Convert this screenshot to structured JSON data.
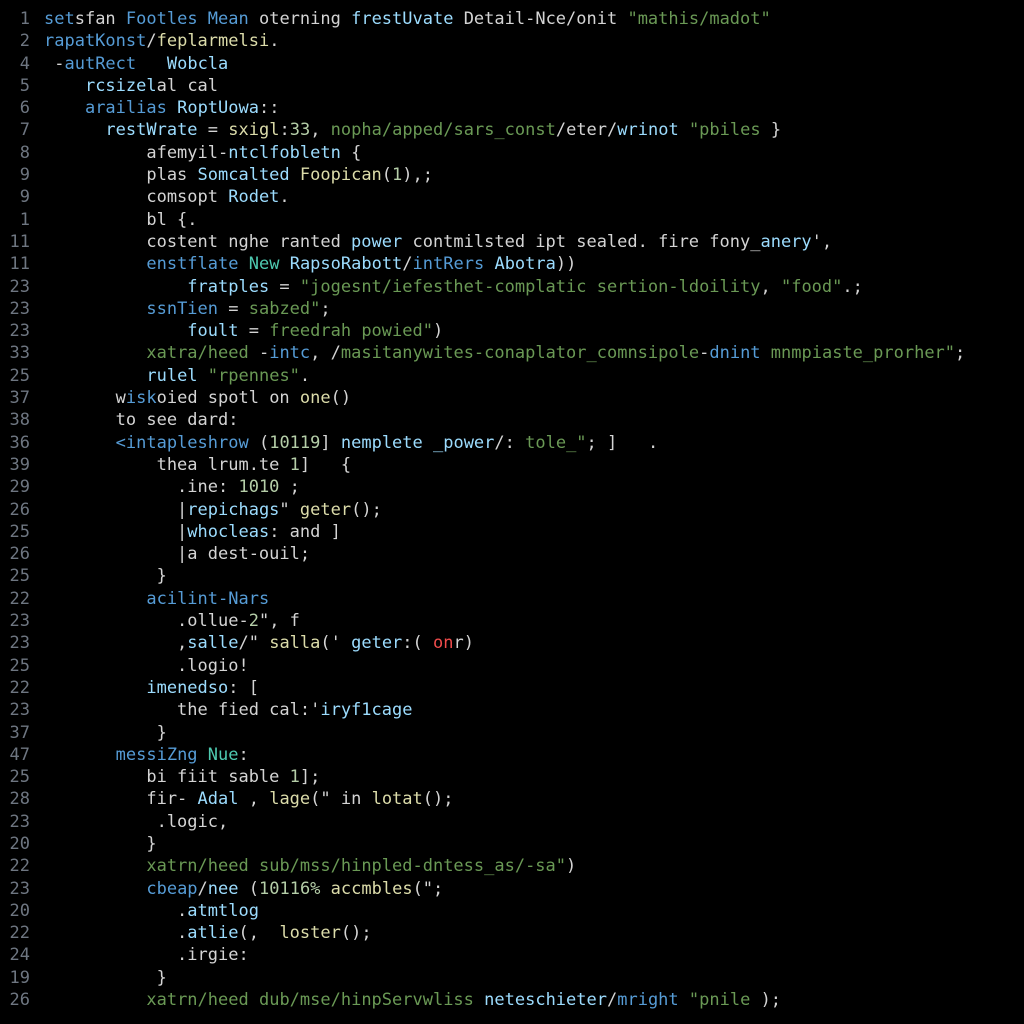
{
  "gutter": [
    "1",
    "2",
    "4",
    "5",
    "6",
    "7",
    "8",
    "9",
    "9",
    "1",
    "11",
    "11",
    "23",
    "23",
    "23",
    "33",
    "25",
    "37",
    "38",
    "36",
    "39",
    "29",
    "26",
    "25",
    "26",
    "25",
    "22",
    "23",
    "23",
    "25",
    "22",
    "23",
    "37",
    "47",
    "25",
    "28",
    "23",
    "20",
    "22",
    "23",
    "20",
    "22",
    "24",
    "19",
    "26"
  ],
  "lines": [
    [
      [
        "kw",
        "set"
      ],
      [
        "pun",
        "sfan "
      ],
      [
        "kw",
        "Footles Mean"
      ],
      [
        "pun",
        " oterning "
      ],
      [
        "fn",
        "frestUvate"
      ],
      [
        "pun",
        " Detail-Nce/onit "
      ],
      [
        "str",
        "\"mathis/madot\""
      ]
    ],
    [
      [
        "kw",
        "rapatKonst"
      ],
      [
        "pun",
        "/"
      ],
      [
        "fnY",
        "feplarmelsi"
      ],
      [
        "pun",
        "."
      ]
    ],
    [
      [
        "pun",
        " -"
      ],
      [
        "kw",
        "autRect"
      ],
      [
        "pun",
        "   "
      ],
      [
        "fn",
        "Wobcla"
      ]
    ],
    [
      [
        "pun",
        "    "
      ],
      [
        "fn",
        "rcsizel"
      ],
      [
        "pun",
        "al cal"
      ]
    ],
    [
      [
        "pun",
        "    "
      ],
      [
        "kw",
        "arailias"
      ],
      [
        "pun",
        " "
      ],
      [
        "fn",
        "RoptUowa"
      ],
      [
        "pun",
        "::"
      ]
    ],
    [
      [
        "pun",
        "      "
      ],
      [
        "fn",
        "restWrate"
      ],
      [
        "pun",
        " = "
      ],
      [
        "fnY",
        "sxigl"
      ],
      [
        "pun",
        ":"
      ],
      [
        "num",
        "33"
      ],
      [
        "pun",
        ", "
      ],
      [
        "str",
        "nopha/apped/sars_const"
      ],
      [
        "pun",
        "/eter/"
      ],
      [
        "fn",
        "wrinot"
      ],
      [
        "pun",
        " "
      ],
      [
        "str",
        "\"pbiles"
      ],
      [
        "pun",
        " }"
      ]
    ],
    [
      [
        "pun",
        "          afemyil-"
      ],
      [
        "fn",
        "ntclfobletn"
      ],
      [
        "pun",
        " {"
      ]
    ],
    [
      [
        "pun",
        "          plas "
      ],
      [
        "fn",
        "Somcalted"
      ],
      [
        "pun",
        " "
      ],
      [
        "fnY",
        "Foopican"
      ],
      [
        "pun",
        "("
      ],
      [
        "num",
        "1"
      ],
      [
        "pun",
        "),;"
      ]
    ],
    [
      [
        "pun",
        "          comsopt "
      ],
      [
        "fn",
        "Rodet"
      ],
      [
        "pun",
        "."
      ]
    ],
    [
      [
        "pun",
        "          bl {."
      ]
    ],
    [
      [
        "pun",
        "          costent nghe ranted "
      ],
      [
        "fn",
        "power"
      ],
      [
        "pun",
        " contmilsted ipt sealed. fire fony_"
      ],
      [
        "fn",
        "anery"
      ],
      [
        "pun",
        "',"
      ]
    ],
    [
      [
        "pun",
        "          "
      ],
      [
        "kw",
        "enstflate"
      ],
      [
        "pun",
        " "
      ],
      [
        "typ",
        "New"
      ],
      [
        "pun",
        " "
      ],
      [
        "fn",
        "RapsoRabott"
      ],
      [
        "pun",
        "/"
      ],
      [
        "kw",
        "intRers"
      ],
      [
        "pun",
        " "
      ],
      [
        "fn",
        "Abotra"
      ],
      [
        "pun",
        "))"
      ]
    ],
    [
      [
        "pun",
        "              "
      ],
      [
        "fn",
        "fratples"
      ],
      [
        "pun",
        " = "
      ],
      [
        "str",
        "\"jogesnt/iefesthet-complatic sertion-ldoility"
      ],
      [
        "pun",
        ", "
      ],
      [
        "str",
        "\"food\""
      ],
      [
        "pun",
        ".;"
      ]
    ],
    [
      [
        "pun",
        "          "
      ],
      [
        "kw",
        "ssnTien"
      ],
      [
        "pun",
        " = "
      ],
      [
        "str",
        "sabzed\""
      ],
      [
        "pun",
        ";"
      ]
    ],
    [
      [
        "pun",
        "              "
      ],
      [
        "fn",
        "foult"
      ],
      [
        "pun",
        " = "
      ],
      [
        "str",
        "freedrah powied\""
      ],
      [
        "pun",
        ")"
      ]
    ],
    [
      [
        "pun",
        "          "
      ],
      [
        "str",
        "xatra/heed"
      ],
      [
        "pun",
        " -"
      ],
      [
        "kw",
        "intc"
      ],
      [
        "pun",
        ", /"
      ],
      [
        "str",
        "masitanywites-conaplator_comnsipole"
      ],
      [
        "pun",
        "-"
      ],
      [
        "kw",
        "dnint"
      ],
      [
        "pun",
        " "
      ],
      [
        "str",
        "mnmpiaste_prorher\""
      ],
      [
        "pun",
        ";"
      ]
    ],
    [
      [
        "pun",
        "          "
      ],
      [
        "fn",
        "rulel"
      ],
      [
        "pun",
        " "
      ],
      [
        "str",
        "\"rpennes\""
      ],
      [
        "pun",
        "."
      ]
    ],
    [
      [
        "pun",
        "       w"
      ],
      [
        "kw",
        "isk"
      ],
      [
        "pun",
        "oied spotl on "
      ],
      [
        "fnY",
        "one"
      ],
      [
        "pun",
        "()"
      ]
    ],
    [
      [
        "pun",
        "       to see dard:"
      ]
    ],
    [
      [
        "pun",
        "       "
      ],
      [
        "kw",
        "<intapleshrow"
      ],
      [
        "pun",
        " ("
      ],
      [
        "num",
        "10119"
      ],
      [
        "pun",
        "] "
      ],
      [
        "fn",
        "nemplete _power"
      ],
      [
        "pun",
        "/: "
      ],
      [
        "str",
        "tole_\""
      ],
      [
        "pun",
        "; ]   ."
      ]
    ],
    [
      [
        "pun",
        "           thea lrum.te "
      ],
      [
        "num",
        "1"
      ],
      [
        "pun",
        "]   {"
      ]
    ],
    [
      [
        "pun",
        "             .ine: "
      ],
      [
        "num",
        "1010"
      ],
      [
        "pun",
        " ;"
      ]
    ],
    [
      [
        "pun",
        "             |"
      ],
      [
        "fn",
        "repichags"
      ],
      [
        "pun",
        "\" "
      ],
      [
        "fnY",
        "geter"
      ],
      [
        "pun",
        "();"
      ]
    ],
    [
      [
        "pun",
        "             |"
      ],
      [
        "fn",
        "whocleas"
      ],
      [
        "pun",
        ": and ]"
      ]
    ],
    [
      [
        "pun",
        "             |a dest-ouil;"
      ]
    ],
    [
      [
        "pun",
        "           }"
      ]
    ],
    [
      [
        "pun",
        "          "
      ],
      [
        "kw",
        "acilint-Nars"
      ]
    ],
    [
      [
        "pun",
        "             .ollue-"
      ],
      [
        "num",
        "2"
      ],
      [
        "pun",
        "\", f"
      ]
    ],
    [
      [
        "pun",
        "             ,"
      ],
      [
        "fn",
        "salle"
      ],
      [
        "pun",
        "/\" "
      ],
      [
        "fnY",
        "salla"
      ],
      [
        "pun",
        "(' "
      ],
      [
        "fn",
        "geter"
      ],
      [
        "pun",
        ":("
      ],
      [
        "err",
        " on"
      ],
      [
        "pun",
        "r)"
      ]
    ],
    [
      [
        "pun",
        "             .logio!"
      ]
    ],
    [
      [
        "pun",
        "          "
      ],
      [
        "fn",
        "imenedso"
      ],
      [
        "pun",
        ": ["
      ]
    ],
    [
      [
        "pun",
        "             the fied cal:'"
      ],
      [
        "fn",
        "iryf1cage"
      ]
    ],
    [
      [
        "pun",
        "           }"
      ]
    ],
    [
      [
        "pun",
        "       "
      ],
      [
        "kw",
        "messiZng"
      ],
      [
        "pun",
        " "
      ],
      [
        "typ",
        "Nue"
      ],
      [
        "pun",
        ":"
      ]
    ],
    [
      [
        "pun",
        "          bi fiit sable "
      ],
      [
        "num",
        "1"
      ],
      [
        "pun",
        "];"
      ]
    ],
    [
      [
        "pun",
        "          fir- "
      ],
      [
        "fn",
        "Adal"
      ],
      [
        "pun",
        " , "
      ],
      [
        "fnY",
        "lage"
      ],
      [
        "pun",
        "(\" in "
      ],
      [
        "fnY",
        "lotat"
      ],
      [
        "pun",
        "();"
      ]
    ],
    [
      [
        "pun",
        "           .logic,"
      ]
    ],
    [
      [
        "pun",
        "          }"
      ]
    ],
    [
      [
        "pun",
        "          "
      ],
      [
        "str",
        "xatrn/heed"
      ],
      [
        "pun",
        " "
      ],
      [
        "str",
        "sub/mss/hinpled-dntess_as/-sa\""
      ],
      [
        "pun",
        ")"
      ]
    ],
    [
      [
        "pun",
        "          "
      ],
      [
        "kw",
        "cbeap"
      ],
      [
        "pun",
        "/"
      ],
      [
        "fn",
        "nee"
      ],
      [
        "pun",
        " ("
      ],
      [
        "num",
        "10116%"
      ],
      [
        "pun",
        " "
      ],
      [
        "fnY",
        "accmbles"
      ],
      [
        "pun",
        "(\";"
      ]
    ],
    [
      [
        "pun",
        "             ."
      ],
      [
        "fn",
        "atmtlog"
      ],
      [
        "pun",
        ""
      ]
    ],
    [
      [
        "pun",
        "             ."
      ],
      [
        "fn",
        "atlie"
      ],
      [
        "pun",
        "(,  "
      ],
      [
        "fnY",
        "loster"
      ],
      [
        "pun",
        "();"
      ]
    ],
    [
      [
        "pun",
        "             .irgie:"
      ]
    ],
    [
      [
        "pun",
        "           }"
      ]
    ],
    [
      [
        "pun",
        "          "
      ],
      [
        "str",
        "xatrn/heed"
      ],
      [
        "pun",
        " "
      ],
      [
        "str",
        "dub/mse/hinpServwliss"
      ],
      [
        "pun",
        " "
      ],
      [
        "fn",
        "neteschieter"
      ],
      [
        "pun",
        "/"
      ],
      [
        "kw",
        "mright"
      ],
      [
        "pun",
        " "
      ],
      [
        "str",
        "\"pnile"
      ],
      [
        "pun",
        " );"
      ]
    ]
  ]
}
